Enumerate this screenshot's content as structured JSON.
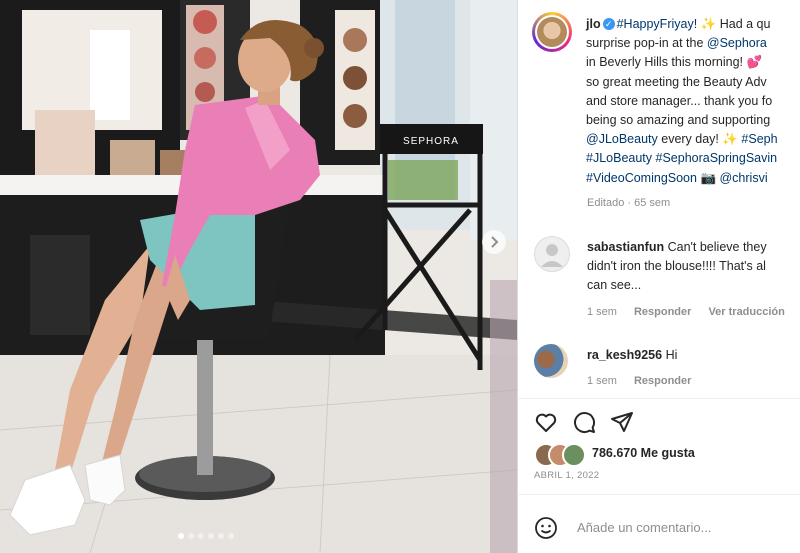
{
  "post": {
    "username": "jlo",
    "caption": {
      "l1_tag": "#HappyFriyay!",
      "l1_rest": "✨ Had a qu",
      "l2_a": "surprise pop-in at the ",
      "l2_tag": "@Sephora",
      "l3": "in Beverly Hills this morning! 💕",
      "l4": "so great meeting the Beauty Adv",
      "l5": "and store manager... thank you fo",
      "l6": "being so amazing and supporting",
      "l7_tag": "@JLoBeauty",
      "l7_rest": " every day! ✨ ",
      "l7_tag2": "#Seph",
      "l8_tag": "#JLoBeauty #SephoraSpringSavin",
      "l9_tag": "#VideoComingSoon",
      "l9_emoji": " 📷 ",
      "l9_tag2": "@chrisvi"
    },
    "edited": "Editado · 65 sem"
  },
  "comments": [
    {
      "username": "sabastianfun",
      "line1": "Can't believe they",
      "line2": "didn't iron the blouse!!!! That's al",
      "line3": "can see...",
      "time": "1 sem",
      "reply": "Responder",
      "translate": "Ver traducción"
    },
    {
      "username": "ra_kesh9256",
      "text": "Hi",
      "time": "1 sem",
      "reply": "Responder"
    }
  ],
  "likes": {
    "count_text": "786.670 Me gusta"
  },
  "date": "ABRIL 1, 2022",
  "add_comment": {
    "placeholder": "Añade un comentario..."
  },
  "photo": {
    "director_chair_text": "SEPHORA"
  },
  "icons": [
    "heart-icon",
    "comment-icon",
    "share-icon",
    "emoji-icon",
    "next-arrow-icon",
    "verified-icon"
  ],
  "colors": {
    "link": "#00376b",
    "muted": "#8e8e8e",
    "verified": "#3897f0"
  }
}
